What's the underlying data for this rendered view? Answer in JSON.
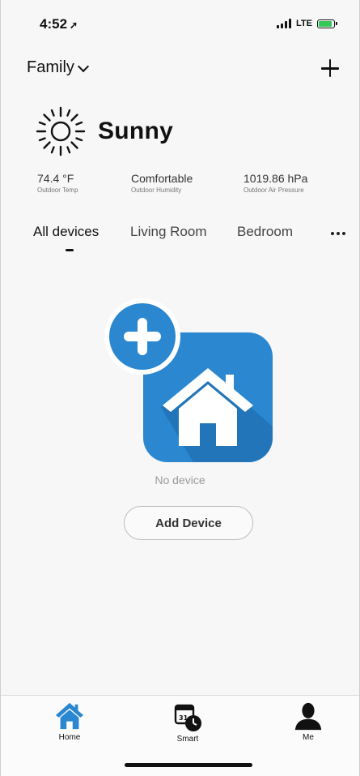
{
  "status_bar": {
    "time": "4:52",
    "network": "LTE"
  },
  "header": {
    "family_label": "Family",
    "add_icon": "plus-icon"
  },
  "weather": {
    "icon": "sun-icon",
    "condition": "Sunny",
    "metrics": [
      {
        "value": "74.4 °F",
        "label": "Outdoor Temp"
      },
      {
        "value": "Comfortable",
        "label": "Outdoor Humidity"
      },
      {
        "value": "1019.86 hPa",
        "label": "Outdoor Air Pressure"
      }
    ]
  },
  "tabs": {
    "items": [
      {
        "label": "All devices"
      },
      {
        "label": "Living Room"
      },
      {
        "label": "Bedroom"
      }
    ],
    "active_index": 0,
    "more_icon": "more-icon"
  },
  "empty_state": {
    "illustration": "add-home-icon",
    "message": "No device",
    "button_label": "Add Device"
  },
  "bottom_nav": {
    "items": [
      {
        "label": "Home",
        "icon": "home-icon"
      },
      {
        "label": "Smart",
        "icon": "calendar-clock-icon"
      },
      {
        "label": "Me",
        "icon": "user-icon"
      }
    ],
    "active_index": 0
  },
  "colors": {
    "accent": "#2a87d0",
    "battery": "#34c759"
  }
}
